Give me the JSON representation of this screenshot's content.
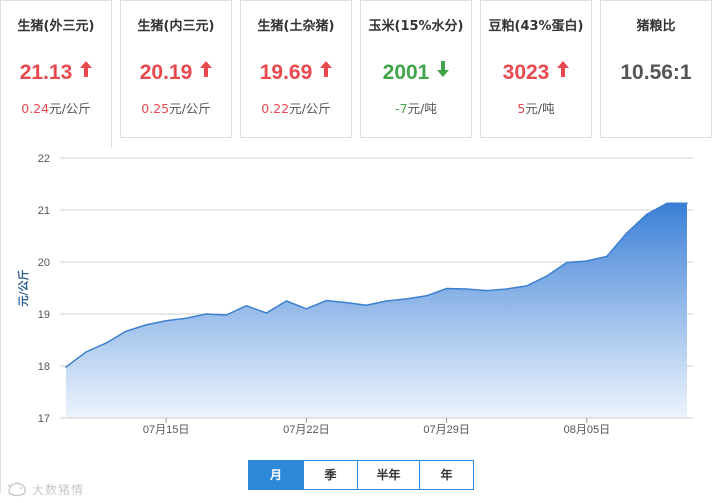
{
  "cards": [
    {
      "title": "生猪(外三元)",
      "value": "21.13",
      "trend": "up",
      "change_value": "0.24",
      "change_unit": "元/公斤",
      "active": true
    },
    {
      "title": "生猪(内三元)",
      "value": "20.19",
      "trend": "up",
      "change_value": "0.25",
      "change_unit": "元/公斤"
    },
    {
      "title": "生猪(土杂猪)",
      "value": "19.69",
      "trend": "up",
      "change_value": "0.22",
      "change_unit": "元/公斤"
    },
    {
      "title": "玉米(15%水分)",
      "value": "2001",
      "trend": "down",
      "change_value": "-7",
      "change_unit": "元/吨"
    },
    {
      "title": "豆粕(43%蛋白)",
      "value": "3023",
      "trend": "up",
      "change_value": "5",
      "change_unit": "元/吨"
    },
    {
      "title": "猪粮比",
      "value": "10.56:1",
      "trend": "none",
      "change_value": "",
      "change_unit": ""
    }
  ],
  "colors": {
    "up": "#e9484f",
    "down": "#3fa44a",
    "accent": "#2e8ad8",
    "line": "#3d80d0"
  },
  "icons": {
    "up": "arrow-up-icon",
    "down": "arrow-down-icon"
  },
  "range_tabs": [
    {
      "label": "月",
      "selected": true
    },
    {
      "label": "季",
      "selected": false
    },
    {
      "label": "半年",
      "selected": false
    },
    {
      "label": "年",
      "selected": false
    }
  ],
  "watermark": "大数猪情",
  "chart_data": {
    "type": "area",
    "title": "",
    "xlabel": "",
    "ylabel": "元/公斤",
    "ylim": [
      17,
      22
    ],
    "yticks": [
      17,
      18,
      19,
      20,
      21,
      22
    ],
    "grid": true,
    "xtick_labels": [
      "07月15日",
      "07月22日",
      "07月29日",
      "08月05日"
    ],
    "x": [
      "07-10",
      "07-11",
      "07-12",
      "07-13",
      "07-14",
      "07-15",
      "07-16",
      "07-17",
      "07-18",
      "07-19",
      "07-20",
      "07-21",
      "07-22",
      "07-23",
      "07-24",
      "07-25",
      "07-26",
      "07-27",
      "07-28",
      "07-29",
      "07-30",
      "07-31",
      "08-01",
      "08-02",
      "08-03",
      "08-04",
      "08-05",
      "08-06",
      "08-07",
      "08-08",
      "08-09",
      "08-10"
    ],
    "series": [
      {
        "values": [
          17.98,
          18.27,
          18.44,
          18.67,
          18.79,
          18.87,
          18.92,
          19.0,
          18.98,
          19.16,
          19.02,
          19.25,
          19.1,
          19.26,
          19.22,
          19.17,
          19.25,
          19.29,
          19.35,
          19.49,
          19.48,
          19.45,
          19.48,
          19.54,
          19.73,
          19.99,
          20.02,
          20.11,
          20.56,
          20.92,
          21.13,
          21.13
        ]
      }
    ]
  }
}
